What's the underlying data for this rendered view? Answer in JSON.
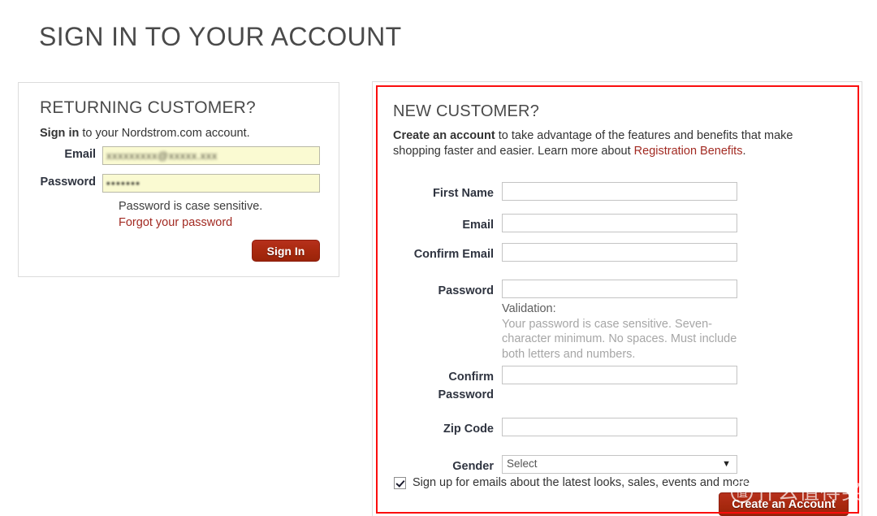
{
  "page": {
    "title": "SIGN IN TO YOUR ACCOUNT"
  },
  "returning": {
    "heading": "RETURNING CUSTOMER?",
    "subtitle_bold": "Sign in",
    "subtitle_rest": " to your Nordstrom.com account.",
    "email_label": "Email",
    "email_value": "xxxxxxxxx@xxxxx.xxx",
    "password_label": "Password",
    "password_value": "•••••••",
    "case_note": "Password is case sensitive.",
    "forgot_link": "Forgot your password",
    "signin_button": "Sign In"
  },
  "newcustomer": {
    "heading": "NEW CUSTOMER?",
    "desc_bold": "Create an account",
    "desc_rest": " to take advantage of the features and benefits that make shopping faster and easier. Learn more about ",
    "desc_link": "Registration Benefits",
    "desc_period": ".",
    "fields": [
      {
        "label": "First Name",
        "value": "",
        "placeholder": ""
      },
      {
        "label": "Email",
        "value": "",
        "placeholder": ""
      },
      {
        "label": "Confirm Email",
        "value": "",
        "placeholder": ""
      },
      {
        "label": "Password",
        "value": "",
        "placeholder": ""
      },
      {
        "label": "Confirm Password",
        "value": "",
        "placeholder": ""
      },
      {
        "label": "Zip Code",
        "value": "",
        "placeholder": ""
      }
    ],
    "validation_heading": "Validation:",
    "validation_body": "Your password is case sensitive. Seven-character minimum. No spaces. Must include both letters and numbers.",
    "gender_label": "Gender",
    "gender_selected": "Select",
    "gender_options": [
      "Select"
    ],
    "gender_arrow": "▼",
    "newsletter_text": "Sign up for emails about the latest looks, sales, events and more",
    "newsletter_checked": true,
    "create_button": "Create an Account"
  },
  "watermark": {
    "logo_char": "值",
    "text": "什么值得买"
  },
  "colors": {
    "accent_red": "#a22a22",
    "button_red": "#a8290f",
    "annotation_red": "#fb0d0d",
    "autofill_yellow": "#fafad2",
    "muted_gray": "#a6a6a6"
  }
}
